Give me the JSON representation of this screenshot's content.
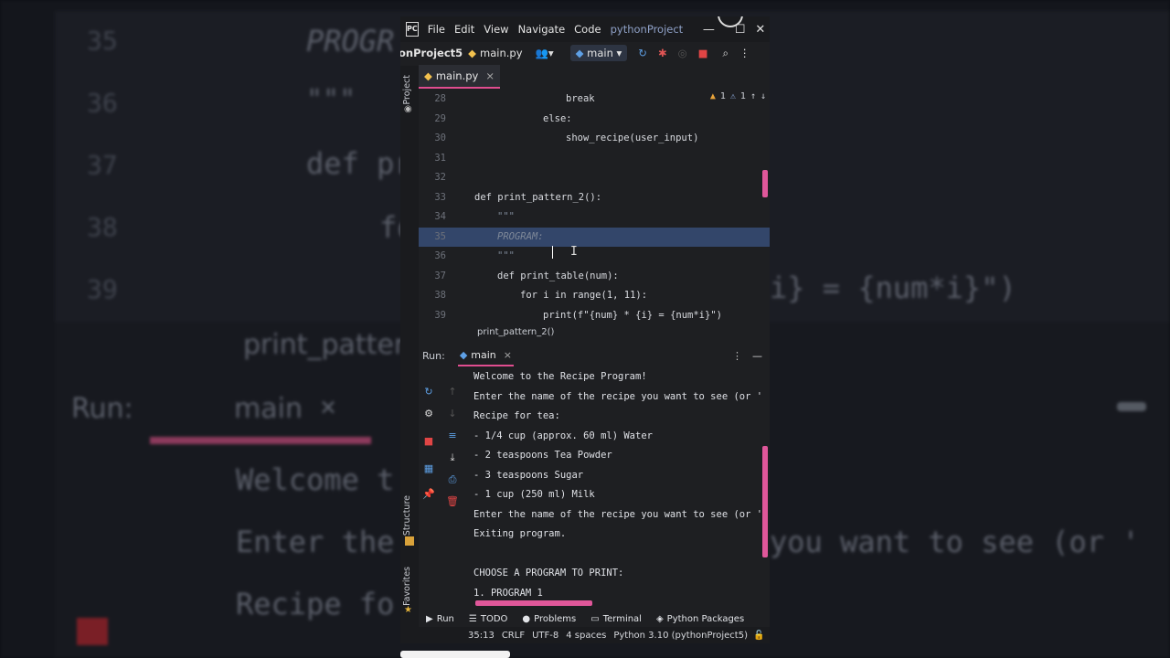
{
  "backdrop": {
    "line_numbers": [
      "35",
      "36",
      "37",
      "38",
      "39"
    ],
    "program_text": "PROGR",
    "docstring": "\"\"\"",
    "def_text": "def pr",
    "fo_text": "fo",
    "formula_text": "i} = {num*i}\")",
    "print_text": "print_patter",
    "run_label": "Run:",
    "main_label": "main",
    "close_x": "×",
    "welcome_text": "Welcome t",
    "enter_text": "Enter the",
    "recipe_text": "Recipe fo",
    "you_want_text": "you want to see (or '"
  },
  "menubar": {
    "items": [
      "File",
      "Edit",
      "View",
      "Navigate",
      "Code"
    ],
    "project": "pythonProject",
    "minimize": "—",
    "maximize": "☐",
    "close": "✕"
  },
  "toolbar": {
    "project_crumb": "onProject5",
    "file_crumb": "main.py",
    "run_config": "main"
  },
  "tabs": {
    "active_tab": "main.py",
    "close": "×"
  },
  "side_labels": {
    "project": "Project",
    "structure": "Structure",
    "favorites": "Favorites"
  },
  "editor": {
    "inspection": {
      "warnings": "1",
      "weak_warnings": "1"
    },
    "lines": [
      {
        "n": "28",
        "indent": 4,
        "text": "break"
      },
      {
        "n": "29",
        "indent": 3,
        "text": "else:"
      },
      {
        "n": "30",
        "indent": 4,
        "text": "show_recipe(user_input)"
      },
      {
        "n": "31",
        "indent": 0,
        "text": ""
      },
      {
        "n": "32",
        "indent": 0,
        "text": ""
      },
      {
        "n": "33",
        "indent": 0,
        "text": "def print_pattern_2():"
      },
      {
        "n": "34",
        "indent": 1,
        "text": "\"\"\""
      },
      {
        "n": "35",
        "indent": 1,
        "text": "PROGRAM:"
      },
      {
        "n": "36",
        "indent": 1,
        "text": "\"\"\""
      },
      {
        "n": "37",
        "indent": 1,
        "text": "def print_table(num):"
      },
      {
        "n": "38",
        "indent": 2,
        "text": "for i in range(1, 11):"
      },
      {
        "n": "39",
        "indent": 3,
        "text": "print(f\"{num} * {i} = {num*i}\")"
      }
    ],
    "highlighted_line": "35",
    "breadcrumb": "print_pattern_2()"
  },
  "run_panel": {
    "label": "Run:",
    "tab": "main",
    "close": "×",
    "output": [
      "Welcome to the Recipe Program!",
      "Enter the name of the recipe you want to see (or '",
      "Recipe for tea:",
      "- 1/4 cup (approx. 60 ml) Water",
      "- 2 teaspoons Tea Powder",
      "- 3 teaspoons Sugar",
      "- 1 cup (250 ml) Milk",
      "Enter the name of the recipe you want to see (or '",
      "Exiting program.",
      "",
      "CHOOSE A PROGRAM TO PRINT:",
      "1. PROGRAM 1"
    ]
  },
  "bottom_tabs": [
    "Run",
    "TODO",
    "Problems",
    "Terminal",
    "Python Packages"
  ],
  "status": {
    "position": "35:13",
    "line_sep": "CRLF",
    "encoding": "UTF-8",
    "indent": "4 spaces",
    "interpreter": "Python 3.10 (pythonProject5)"
  },
  "colors": {
    "accent": "#e04d8f",
    "selection": "#33466a",
    "background": "#1e1f22"
  }
}
